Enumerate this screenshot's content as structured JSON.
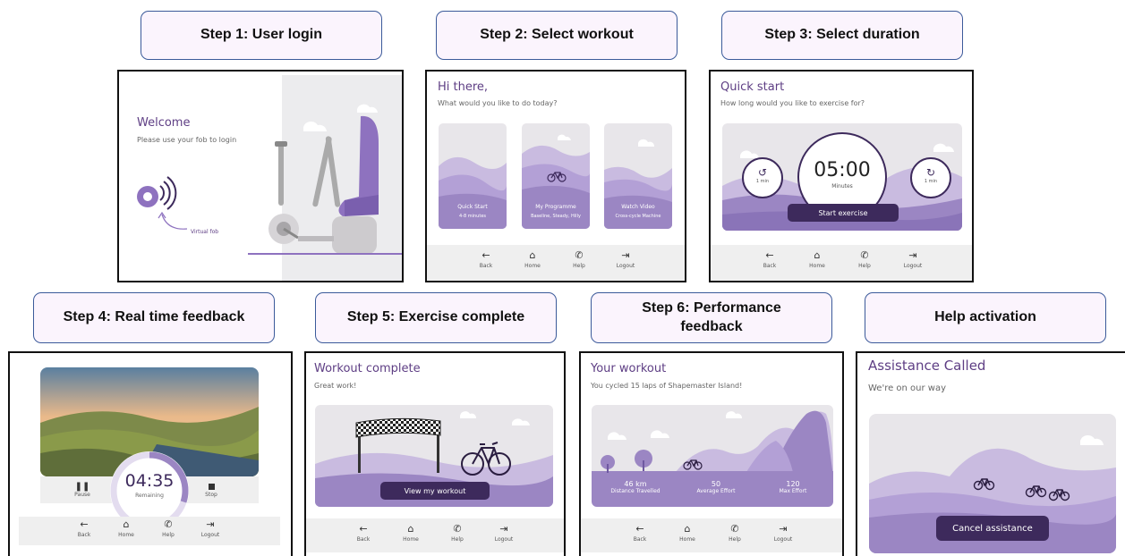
{
  "steps": {
    "s1": "Step 1: User login",
    "s2": "Step 2: Select workout",
    "s3": "Step 3: Select duration",
    "s4": "Step 4: Real time feedback",
    "s5": "Step 5: Exercise complete",
    "s6_line1": "Step 6: Performance",
    "s6_line2": "feedback",
    "help": "Help activation"
  },
  "nav": {
    "back": "Back",
    "home": "Home",
    "help": "Help",
    "logout": "Logout"
  },
  "screen1": {
    "title": "Welcome",
    "subtitle": "Please use your fob to login",
    "fob_label": "Virtual fob"
  },
  "screen2": {
    "title": "Hi there,",
    "subtitle": "What would you like to do today?",
    "cards": [
      {
        "label": "Quick Start",
        "sub": "4-8 minutes"
      },
      {
        "label": "My Programme",
        "sub": "Baseline, Steady, Hilly"
      },
      {
        "label": "Watch Video",
        "sub": "Cross-cycle Machine"
      }
    ]
  },
  "screen3": {
    "title": "Quick start",
    "subtitle": "How long would you like to exercise for?",
    "minus_label": "1 min",
    "plus_label": "1 min",
    "time": "05:00",
    "time_unit": "Minutes",
    "start_button": "Start exercise"
  },
  "screen4": {
    "time": "04:35",
    "time_label": "Remaining",
    "pause": "Pause",
    "stop": "Stop",
    "progress": 0.3
  },
  "screen5": {
    "title": "Workout complete",
    "subtitle": "Great work!",
    "button": "View my workout"
  },
  "screen6": {
    "title": "Your workout",
    "subtitle": "You cycled 15 laps of Shapemaster Island!",
    "stats": [
      {
        "value": "46 km",
        "label": "Distance Travelled"
      },
      {
        "value": "50",
        "label": "Average Effort"
      },
      {
        "value": "120",
        "label": "Max Effort"
      }
    ]
  },
  "screen7": {
    "title": "Assistance Called",
    "subtitle": "We're on our way",
    "button": "Cancel assistance"
  },
  "colors": {
    "purple": "#9b86c3",
    "light_purple": "#c9bbe0",
    "dark_purple": "#3d2a5c",
    "title": "#5e3e84"
  }
}
